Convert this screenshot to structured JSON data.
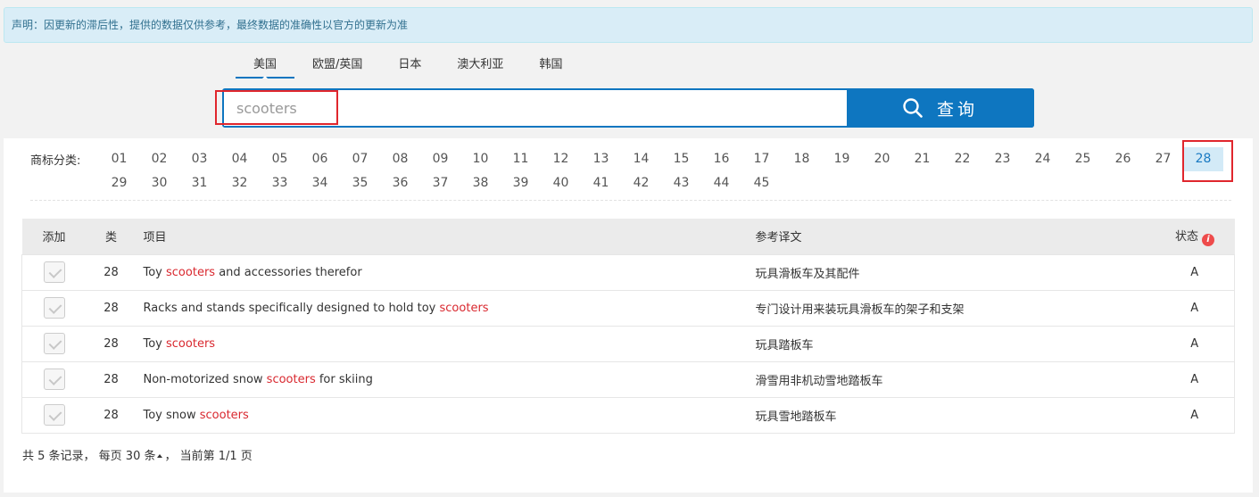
{
  "notice": "声明：因更新的滞后性，提供的数据仅供参考，最终数据的准确性以官方的更新为准",
  "tabs": [
    "美国",
    "欧盟/英国",
    "日本",
    "澳大利亚",
    "韩国"
  ],
  "search": {
    "placeholder": "scooters",
    "button_label": "查询"
  },
  "classes": {
    "label": "商标分类:",
    "selected": "28",
    "items": [
      "01",
      "02",
      "03",
      "04",
      "05",
      "06",
      "07",
      "08",
      "09",
      "10",
      "11",
      "12",
      "13",
      "14",
      "15",
      "16",
      "17",
      "18",
      "19",
      "20",
      "21",
      "22",
      "23",
      "24",
      "25",
      "26",
      "27",
      "28",
      "29",
      "30",
      "31",
      "32",
      "33",
      "34",
      "35",
      "36",
      "37",
      "38",
      "39",
      "40",
      "41",
      "42",
      "43",
      "44",
      "45"
    ]
  },
  "table": {
    "headers": {
      "add": "添加",
      "cls": "类",
      "item": "项目",
      "translation": "参考译文",
      "status": "状态"
    },
    "keyword": "scooters",
    "rows": [
      {
        "cls": "28",
        "before": "Toy ",
        "kw": "scooters",
        "after": " and accessories therefor",
        "translation": "玩具滑板车及其配件",
        "status": "A"
      },
      {
        "cls": "28",
        "before": "Racks and stands specifically designed to hold toy ",
        "kw": "scooters",
        "after": "",
        "translation": "专门设计用来装玩具滑板车的架子和支架",
        "status": "A"
      },
      {
        "cls": "28",
        "before": "Toy ",
        "kw": "scooters",
        "after": "",
        "translation": "玩具踏板车",
        "status": "A"
      },
      {
        "cls": "28",
        "before": "Non-motorized snow ",
        "kw": "scooters",
        "after": " for skiing",
        "translation": "滑雪用非机动雪地踏板车",
        "status": "A"
      },
      {
        "cls": "28",
        "before": "Toy snow ",
        "kw": "scooters",
        "after": "",
        "translation": "玩具雪地踏板车",
        "status": "A"
      }
    ]
  },
  "footer": {
    "part1": "共 5 条记录， 每页 30 条",
    "part2": "， 当前第 1/1 页"
  },
  "colors": {
    "accent": "#0e76c0",
    "keyword": "#d9282f",
    "highlight_box": "#e0262d"
  }
}
